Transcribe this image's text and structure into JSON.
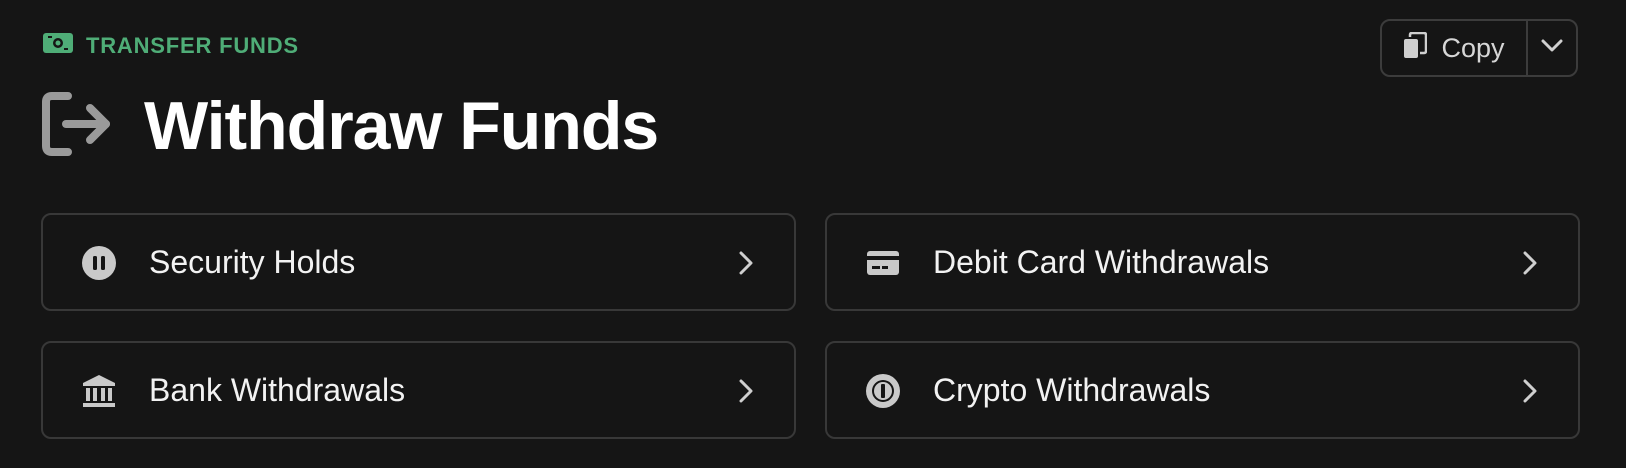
{
  "eyebrow": {
    "label": "TRANSFER FUNDS",
    "icon": "money-transfer-icon",
    "color": "#4fad77"
  },
  "header": {
    "title": "Withdraw Funds",
    "icon": "sign-out-arrow-icon"
  },
  "toolbar": {
    "copy_label": "Copy",
    "copy_icon": "copy-icon",
    "menu_icon": "chevron-down-icon"
  },
  "cards": [
    {
      "label": "Security Holds",
      "icon": "pause-circle-icon"
    },
    {
      "label": "Debit Card Withdrawals",
      "icon": "credit-card-icon"
    },
    {
      "label": "Bank Withdrawals",
      "icon": "bank-icon"
    },
    {
      "label": "Crypto Withdrawals",
      "icon": "crypto-coin-icon"
    }
  ],
  "colors": {
    "background": "#151515",
    "accent": "#4fad77",
    "border": "#383838",
    "text": "#f2f2f2"
  }
}
